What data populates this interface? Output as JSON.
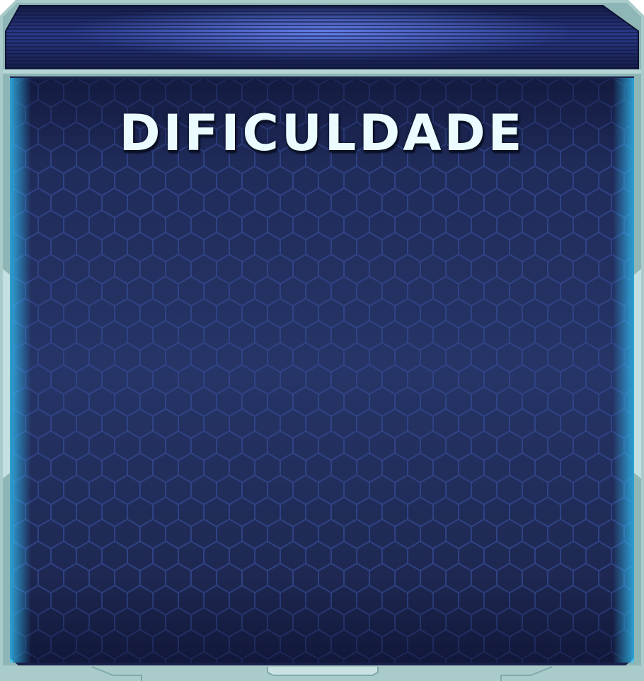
{
  "panel": {
    "title": "DIFICULDADE"
  },
  "colors": {
    "frame": "#a9cccb",
    "frame_dark": "#6f9c9c",
    "header_bg": "#1c2658",
    "header_glow": "#4a64c8",
    "body_bg": "#243263",
    "hex_line": "#31458a",
    "inner_glow": "#2fa6ff",
    "title_text": "#eafcff"
  }
}
